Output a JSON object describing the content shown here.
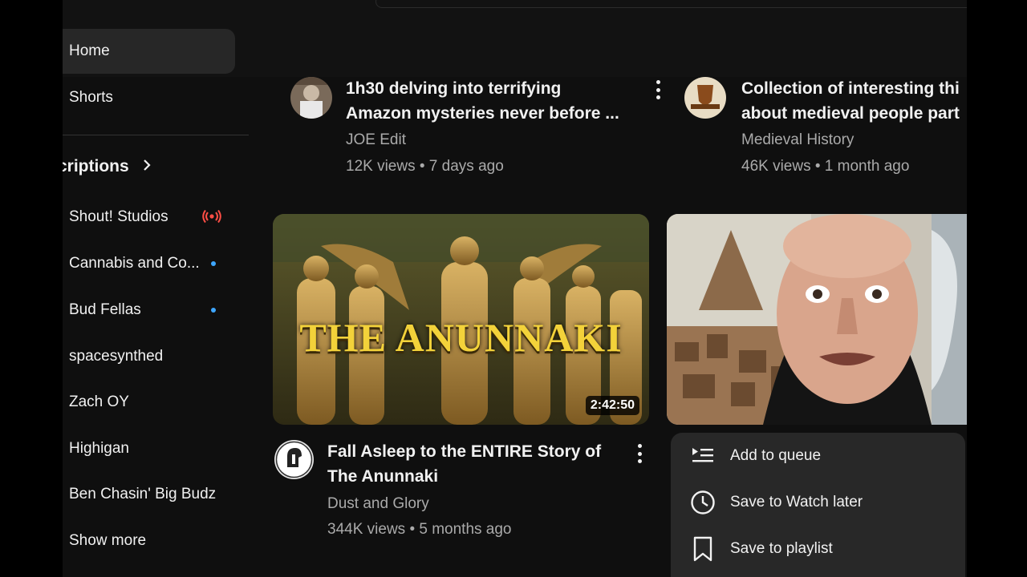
{
  "sidebar": {
    "home": "Home",
    "shorts": "Shorts",
    "subscriptions_heading": "criptions",
    "subscriptions": [
      {
        "name": "Shout! Studios",
        "indicator": "live"
      },
      {
        "name": "Cannabis and Co...",
        "indicator": "new"
      },
      {
        "name": "Bud Fellas",
        "indicator": "new"
      },
      {
        "name": "spacesynthed",
        "indicator": ""
      },
      {
        "name": "Zach OY",
        "indicator": ""
      },
      {
        "name": "Highigan",
        "indicator": ""
      },
      {
        "name": "Ben Chasin' Big Budz",
        "indicator": ""
      }
    ],
    "show_more": "Show more"
  },
  "videos": [
    {
      "title_line1": "1h30 delving into terrifying",
      "title_line2": "Amazon mysteries never before ...",
      "channel": "JOE Edit",
      "stats": "12K views • 7 days ago"
    },
    {
      "title_line1": "Collection of interesting thi",
      "title_line2": "about medieval people part",
      "channel": "Medieval History",
      "stats": "46K views • 1 month ago"
    },
    {
      "thumbnail_text": "THE ANUNNAKI",
      "duration": "2:42:50",
      "title_line1": "Fall Asleep to the ENTIRE Story of",
      "title_line2": "The Anunnaki",
      "channel": "Dust and Glory",
      "stats": "344K views • 5 months ago"
    }
  ],
  "context_menu": [
    {
      "label": "Add to queue",
      "icon": "add-to-queue-icon"
    },
    {
      "label": "Save to Watch later",
      "icon": "clock-icon"
    },
    {
      "label": "Save to playlist",
      "icon": "bookmark-icon"
    }
  ],
  "colors": {
    "background": "#0f0f0f",
    "active_item": "#272727",
    "menu": "#282828",
    "new_dot": "#3ea6ff",
    "live": "#ff4e45",
    "thumbnail_title": "#f3d23a"
  }
}
